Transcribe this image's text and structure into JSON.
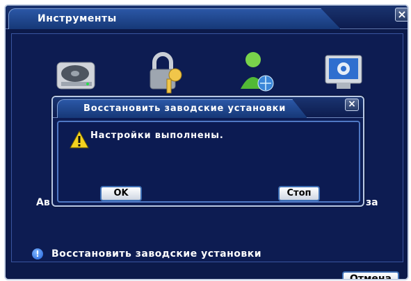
{
  "window": {
    "title": "Инструменты",
    "close_glyph": "×",
    "cancel_label": "Отмена",
    "tools": [
      {
        "icon": "hard-drive-icon",
        "label_fragment": ""
      },
      {
        "icon": "lock-key-icon",
        "label_fragment": ""
      },
      {
        "icon": "user-network-icon",
        "label_fragment": ""
      },
      {
        "icon": "monitor-gear-icon",
        "label_fragment": ""
      }
    ],
    "left_label_fragment": "Ав",
    "right_label_fragment": "за",
    "info_text": "Восстановить заводские установки"
  },
  "dialog": {
    "title": "Восстановить заводские установки",
    "close_glyph": "×",
    "message": "Настройки выполнены.",
    "ok_label": "OK",
    "stop_label": "Стоп"
  },
  "colors": {
    "background": "#0d1c52",
    "title_tab": "#2b57a6",
    "border": "#b9c9e6",
    "button_border": "#3e6fb5",
    "warning": "#f4d21f"
  }
}
